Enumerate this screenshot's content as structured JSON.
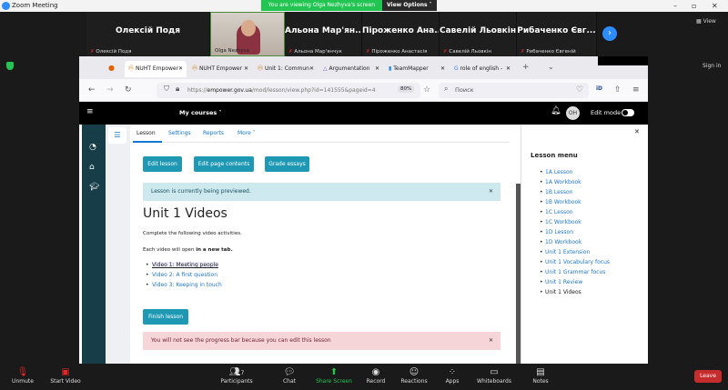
{
  "zoom": {
    "title": "Zoom Meeting",
    "banner": "You are viewing Olga Nezhyva's screen",
    "view_options": "View Options",
    "view": "View",
    "sign_in": "Sign in",
    "participants": [
      {
        "big": "Олексій Подя",
        "small": "Олексій Подя"
      },
      {
        "big": "",
        "small": "Olga Nezhyva"
      },
      {
        "big": "Альона Мар'ян...",
        "small": "Альона Мар'янчук"
      },
      {
        "big": "Піроженко Ана...",
        "small": "Піроженко Анастасія"
      },
      {
        "big": "Савелій Льовкін",
        "small": "Савелій Льовкін"
      },
      {
        "big": "Рибаченко Євг...",
        "small": "Рибаченко Євгеній"
      }
    ],
    "toolbar": {
      "unmute": "Unmute",
      "start_video": "Start Video",
      "participants": "Participants",
      "participants_count": "7",
      "chat": "Chat",
      "share": "Share Screen",
      "record": "Record",
      "reactions": "Reactions",
      "apps": "Apps",
      "whiteboards": "Whiteboards",
      "notes": "Notes",
      "leave": "Leave"
    }
  },
  "browser": {
    "tabs": [
      "NUHT Empower",
      "NUHT Empower",
      "Unit 1: Commun",
      "Argumentation",
      "TeamMapper",
      "role of english -"
    ],
    "url_prefix": "https://",
    "url_domain": "empower.gov.ua",
    "url_path": "/mod/lesson/view.php?id=141555&pageid=4",
    "zoom": "80%",
    "search_placeholder": "Поиск"
  },
  "moodle": {
    "my_courses": "My courses",
    "avatar": "OH",
    "edit_mode": "Edit mode",
    "tabs": [
      "Lesson",
      "Settings",
      "Reports",
      "More"
    ],
    "buttons": [
      "Edit lesson",
      "Edit page contents",
      "Grade essays"
    ],
    "preview_alert": "Lesson is currently being previewed.",
    "title": "Unit 1 Videos",
    "intro": "Complete the following video activities.",
    "note_prefix": "Each video will open ",
    "note_bold": "in a new tab.",
    "videos": [
      "Video 1: Meeting people",
      "Video 2: A first question",
      "Video 3: Keeping in touch"
    ],
    "finish": "Finish lesson",
    "progress_alert": "You will not see the progress bar because you can edit this lesson",
    "menu_title": "Lesson menu",
    "menu": [
      "1A Lesson",
      "1A Workbook",
      "1B Lesson",
      "1B Workbook",
      "1C Lesson",
      "1C Workbook",
      "1D Lesson",
      "1D Workbook",
      "Unit 1 Extension",
      "Unit 1 Vocabulary focus",
      "Unit 1 Grammar focus",
      "Unit 1 Review",
      "Unit 1 Videos"
    ]
  }
}
